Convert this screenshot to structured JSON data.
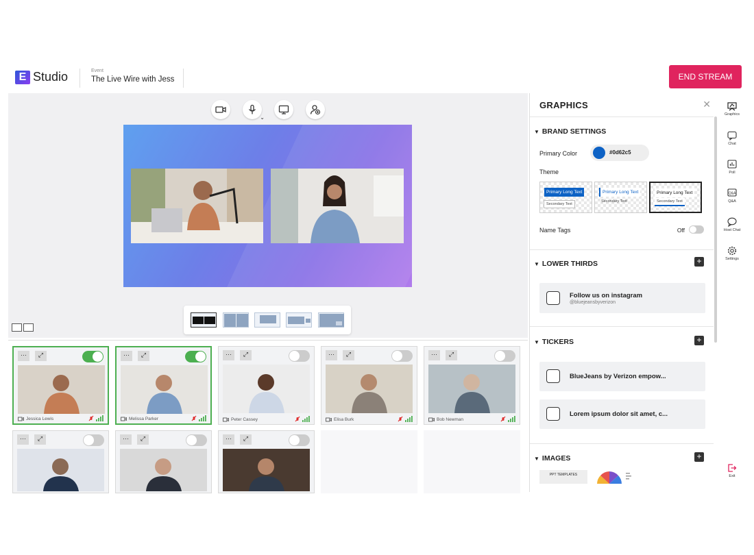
{
  "app": {
    "logo_mark": "E",
    "logo_text": "Studio"
  },
  "event": {
    "label": "Event",
    "title": "The Live Wire with Jess"
  },
  "header": {
    "end_stream_label": "END STREAM"
  },
  "stage": {
    "toolbar": [
      "camera-icon",
      "microphone-icon",
      "screen-share-icon",
      "add-participant-icon"
    ],
    "layouts": [
      "two-split",
      "grid-two",
      "single",
      "side-by-side",
      "picture-in-picture"
    ],
    "selected_layout": 0
  },
  "participants": [
    {
      "name": "Jessica Lewis",
      "live": true
    },
    {
      "name": "Melissa Parker",
      "live": true
    },
    {
      "name": "Peter Cassey",
      "live": false
    },
    {
      "name": "Elisa Burk",
      "live": false
    },
    {
      "name": "Bob Newman",
      "live": false
    },
    {
      "name": "",
      "live": false
    },
    {
      "name": "",
      "live": false
    },
    {
      "name": "",
      "live": false
    }
  ],
  "graphics": {
    "title": "GRAPHICS",
    "brand_settings": {
      "title": "BRAND SETTINGS",
      "primary_color_label": "Primary Color",
      "primary_color": "#0d62c5",
      "theme_label": "Theme",
      "themes": [
        {
          "primary": "Primary Long Text",
          "secondary": "Secondary Text"
        },
        {
          "primary": "Primary Long Text",
          "secondary": "Secondary Text"
        },
        {
          "primary": "Primary Long Text",
          "secondary": "Secondary Text"
        }
      ],
      "name_tags_label": "Name Tags",
      "name_tags_state": "Off"
    },
    "lower_thirds": {
      "title": "LOWER THIRDS",
      "items": [
        {
          "text": "Follow us on instagram",
          "sub": "@bluejeansbyverizon"
        }
      ]
    },
    "tickers": {
      "title": "TICKERS",
      "items": [
        {
          "text": "BlueJeans by Verizon empow..."
        },
        {
          "text": "Lorem ipsum dolor sit amet, c..."
        }
      ]
    },
    "images": {
      "title": "IMAGES",
      "thumb_label": "PPT TEMPLATES"
    }
  },
  "rail": [
    {
      "label": "Graphics",
      "icon": "graphics-icon"
    },
    {
      "label": "Chat",
      "icon": "chat-icon"
    },
    {
      "label": "Poll",
      "icon": "poll-icon"
    },
    {
      "label": "Q&A",
      "icon": "qa-icon"
    },
    {
      "label": "Host Chat",
      "icon": "host-chat-icon"
    },
    {
      "label": "Settings",
      "icon": "settings-icon"
    },
    {
      "label": "Exit",
      "icon": "exit-icon"
    }
  ],
  "colors": {
    "accent": "#e0245e",
    "live_green": "#4caf50",
    "signal_red": "#e03030"
  }
}
